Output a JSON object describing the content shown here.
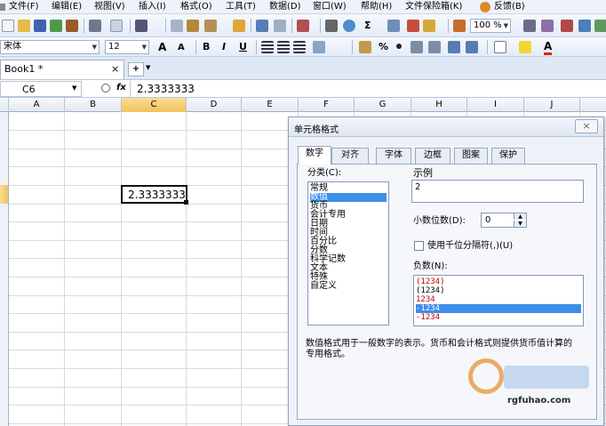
{
  "menubar": {
    "items": [
      "文件(F)",
      "编辑(E)",
      "视图(V)",
      "插入(I)",
      "格式(O)",
      "工具(T)",
      "数据(D)",
      "窗口(W)",
      "帮助(H)",
      "文件保险箱(K)",
      "反馈(B)"
    ]
  },
  "toolbar": {
    "zoom": "100 %",
    "sigma": "Σ"
  },
  "format_toolbar": {
    "font_name": "宋体",
    "font_size": "12",
    "bold": "B",
    "italic": "I",
    "underline": "U",
    "percent": "%"
  },
  "tabs": {
    "book_title": "Book1 *",
    "close_glyph": "×",
    "new_glyph": "+"
  },
  "formula_bar": {
    "name_box": "C6",
    "fx": "fx",
    "content": "2.3333333"
  },
  "sheet": {
    "columns": [
      "A",
      "B",
      "C",
      "D",
      "E",
      "F",
      "G",
      "H",
      "I",
      "J"
    ],
    "selected_column": "C",
    "active_cell_value": "2.3333333"
  },
  "dialog": {
    "title": "单元格格式",
    "close_glyph": "×",
    "tabs": [
      "数字",
      "对齐",
      "字体",
      "边框",
      "图案",
      "保护"
    ],
    "active_tab": "数字",
    "category_label": "分类(C):",
    "categories": [
      "常规",
      "数值",
      "货币",
      "会计专用",
      "日期",
      "时间",
      "百分比",
      "分数",
      "科学记数",
      "文本",
      "特殊",
      "自定义"
    ],
    "selected_category": "数值",
    "sample_label": "示例",
    "sample_value": "2",
    "decimal_label": "小数位数(D):",
    "decimal_value": "0",
    "thousands_label": "使用千位分隔符(,)(U)",
    "negative_label": "负数(N):",
    "negative_options": [
      "(1234)",
      "(1234)",
      "1234",
      "-1234",
      "-1234"
    ],
    "negative_colors": [
      "#c00000",
      "#000000",
      "#c00000",
      "#ffffff",
      "#c00000"
    ],
    "selected_negative_index": 3,
    "description": "数值格式用于一般数字的表示。货币和会计格式则提供货币值计算的专用格式。"
  },
  "watermark": {
    "site": "rgfuhao.com"
  }
}
